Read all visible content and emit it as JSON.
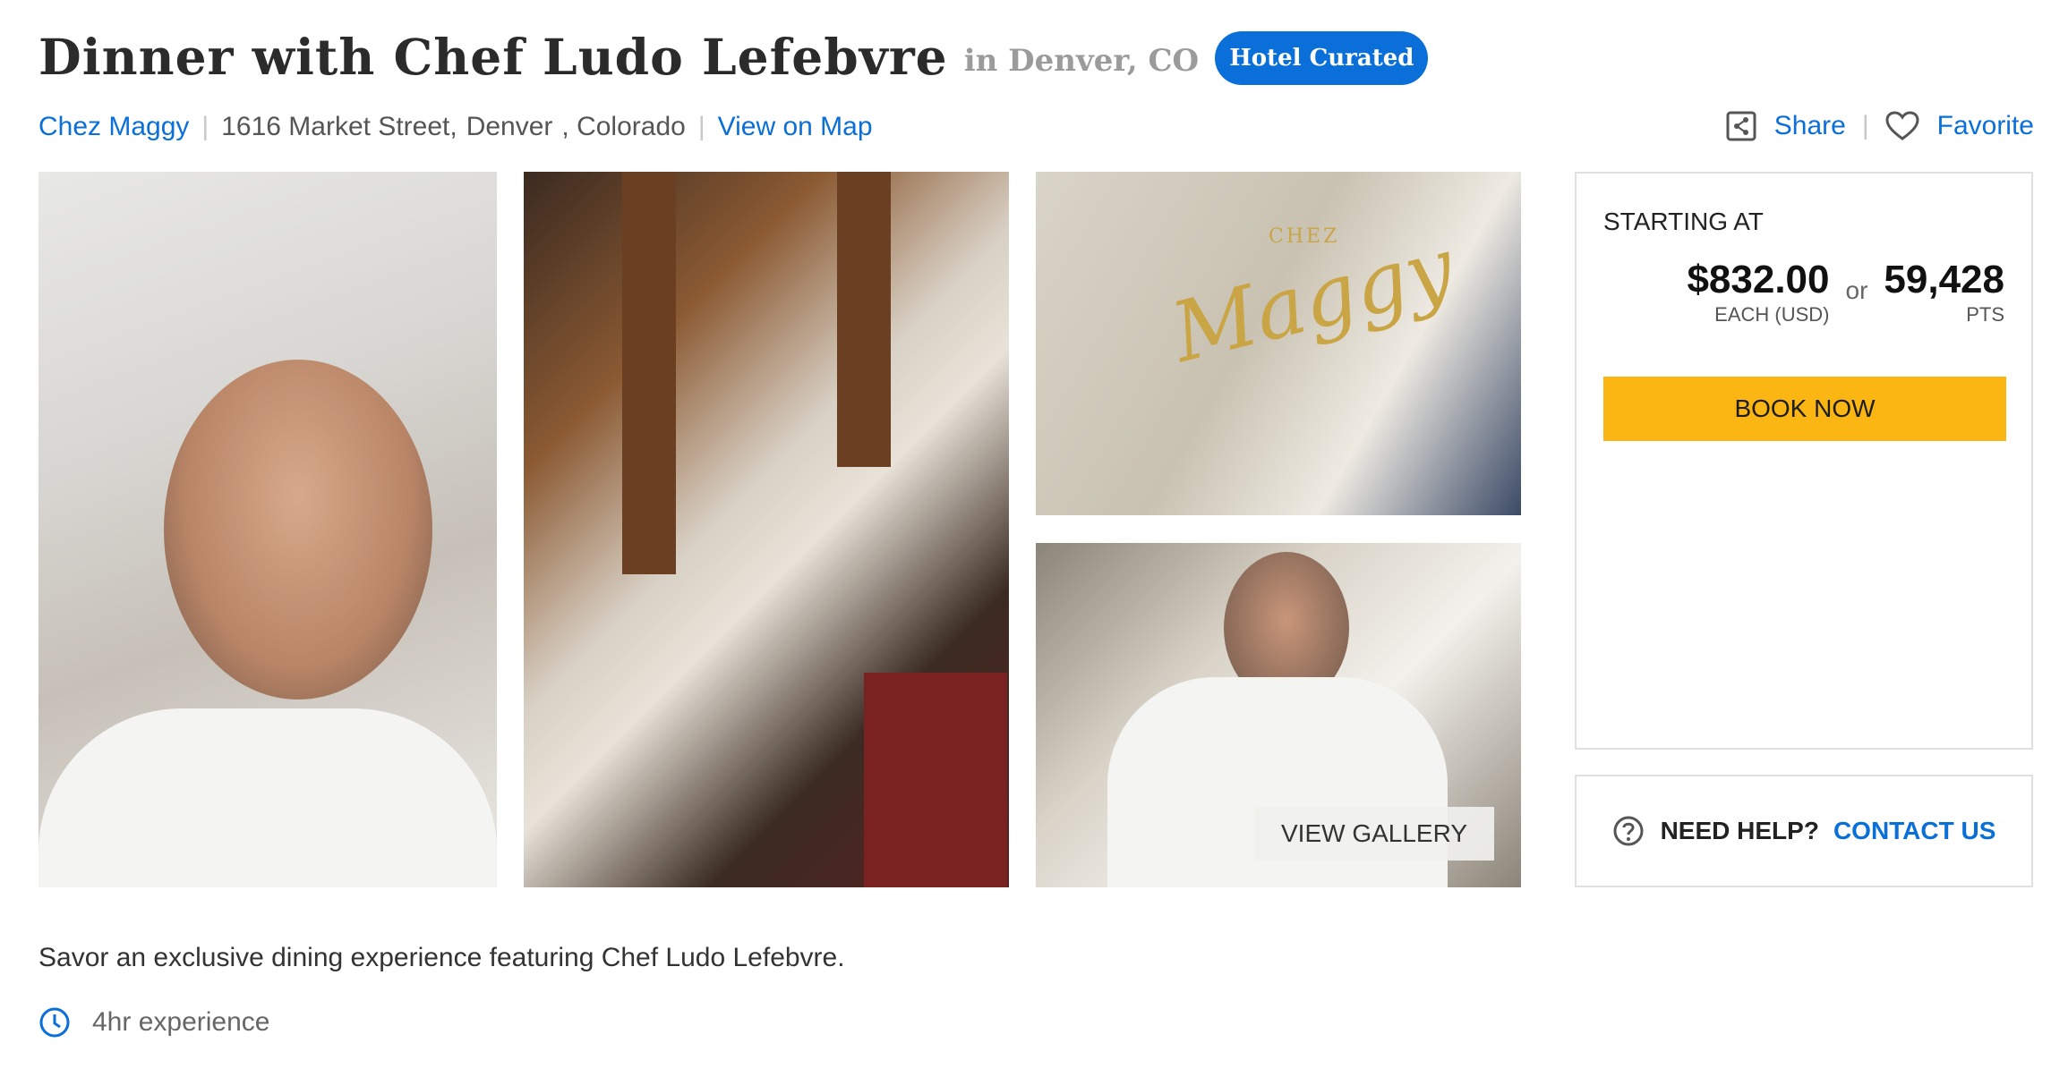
{
  "header": {
    "title": "Dinner with Chef Ludo Lefebvre",
    "location": "in Denver, CO",
    "badge": "Hotel Curated"
  },
  "venue": {
    "name": "Chez Maggy",
    "street": "1616 Market Street,",
    "city": "Denver",
    "state": ", Colorado",
    "map_link": "View on Map"
  },
  "actions": {
    "share": "Share",
    "favorite": "Favorite",
    "share_icon": "share-icon",
    "favorite_icon": "heart-icon"
  },
  "gallery": {
    "sign_brand": "CHEZ",
    "sign_script": "Maggy",
    "view_gallery": "VIEW GALLERY"
  },
  "pricing": {
    "starting_label": "STARTING AT",
    "cash_price": "$832.00",
    "cash_caption": "EACH (USD)",
    "or": "or",
    "points": "59,428",
    "points_caption": "PTS",
    "book_label": "BOOK NOW"
  },
  "help": {
    "question": "NEED HELP?",
    "contact": "CONTACT US",
    "icon": "question-circle-icon"
  },
  "details": {
    "description": "Savor an exclusive dining experience featuring Chef Ludo Lefebvre.",
    "duration": "4hr experience",
    "duration_icon": "clock-icon"
  },
  "colors": {
    "link_blue": "#0a6fd8",
    "book_yellow": "#fbb613",
    "badge_blue": "#0a6fd8"
  }
}
